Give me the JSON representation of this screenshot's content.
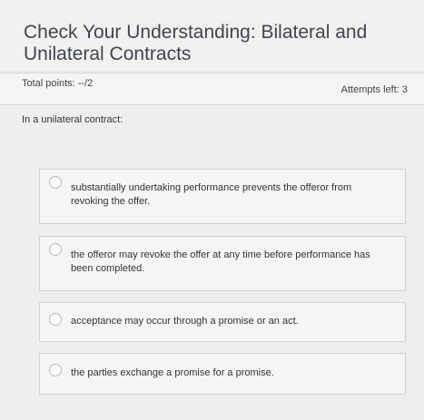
{
  "quiz": {
    "title": "Check Your Understanding: Bilateral and Unilateral Contracts",
    "total_points": "Total points: --/2",
    "attempts": "Attempts left: 3",
    "question": "In a unilateral contract:",
    "options": [
      {
        "label": "substantially undertaking performance prevents the offeror from revoking the offer."
      },
      {
        "label": "the offeror may revoke the offer at any time before performance has been completed."
      },
      {
        "label": "acceptance may occur through a promise or an act."
      },
      {
        "label": "the parties exchange a promise for a promise."
      }
    ]
  }
}
